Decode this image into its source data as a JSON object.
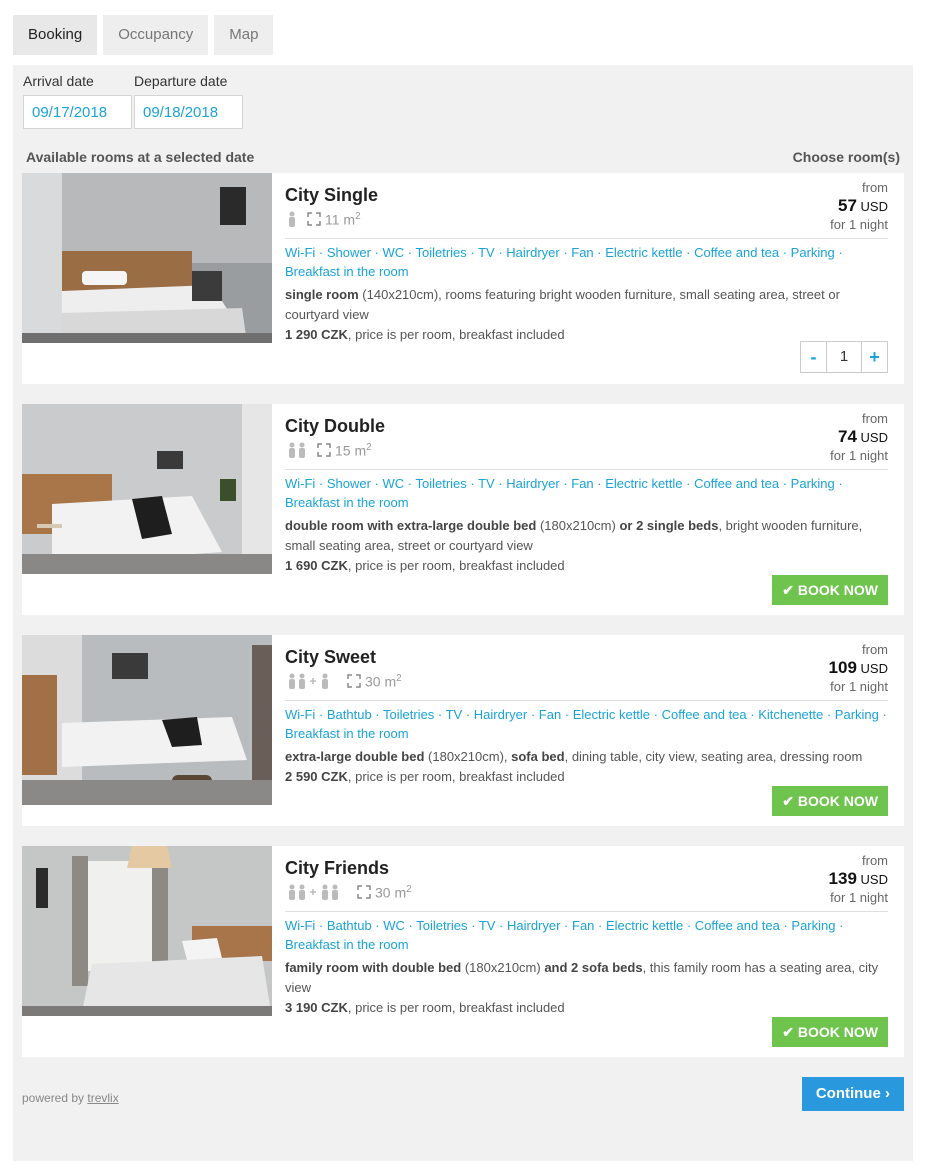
{
  "tabs": [
    {
      "label": "Booking"
    },
    {
      "label": "Occupancy"
    },
    {
      "label": "Map"
    }
  ],
  "dates": {
    "arrival_label": "Arrival date",
    "arrival_value": "09/17/2018",
    "departure_label": "Departure date",
    "departure_value": "09/18/2018"
  },
  "section": {
    "left": "Available rooms at a selected date",
    "right": "Choose room(s)"
  },
  "rooms": [
    {
      "name": "City Single",
      "size": "11 m",
      "price_from": "from",
      "price": "57",
      "currency": "USD",
      "nights": "for 1 night",
      "amenities": "Wi-Fi · Shower · WC · Toiletries · TV · Hairdryer · Fan · Electric kettle · Coffee and tea · Parking · Breakfast in the room",
      "desc_bold": "single room",
      "desc_rest": " (140x210cm), rooms featuring bright wooden furniture, small seating area, street or courtyard view",
      "price_czk": "1 290 CZK",
      "price_note": ", price is per room, breakfast included",
      "quantity": "1",
      "minus": "-",
      "plus": "+"
    },
    {
      "name": "City Double",
      "size": "15 m",
      "price_from": "from",
      "price": "74",
      "currency": "USD",
      "nights": "for 1 night",
      "amenities": "Wi-Fi · Shower · WC · Toiletries · TV · Hairdryer · Fan · Electric kettle · Coffee and tea · Parking · Breakfast in the room",
      "desc_bold": "double room with extra-large double bed",
      "desc_mid": " (180x210cm) ",
      "desc_bold2": "or 2 single beds",
      "desc_rest": ", bright wooden furniture, small seating area, street or courtyard view",
      "price_czk": "1 690 CZK",
      "price_note": ", price is per room, breakfast included",
      "book": "BOOK NOW"
    },
    {
      "name": "City Sweet",
      "size": "30 m",
      "price_from": "from",
      "price": "109",
      "currency": "USD",
      "nights": "for 1 night",
      "amenities": "Wi-Fi · Bathtub · Toiletries · TV · Hairdryer · Fan · Electric kettle · Coffee and tea · Kitchenette · Parking · Breakfast in the room",
      "desc_bold": "extra-large double bed",
      "desc_mid": " (180x210cm), ",
      "desc_bold2": "sofa bed",
      "desc_rest": ", dining table, city view, seating area, dressing room",
      "price_czk": "2 590 CZK",
      "price_note": ", price is per room, breakfast included",
      "book": "BOOK NOW"
    },
    {
      "name": "City Friends",
      "size": "30 m",
      "price_from": "from",
      "price": "139",
      "currency": "USD",
      "nights": "for 1 night",
      "amenities": "Wi-Fi · Bathtub · WC · Toiletries · TV · Hairdryer · Fan · Electric kettle · Coffee and tea · Parking · Breakfast in the room",
      "desc_bold": "family room with double bed",
      "desc_mid": " (180x210cm) ",
      "desc_bold2": "and 2 sofa beds",
      "desc_rest": ", this family room has a seating area, city view",
      "price_czk": "3 190 CZK",
      "price_note": ", price is per room, breakfast included",
      "book": "BOOK NOW"
    }
  ],
  "sup2": "2",
  "footer": {
    "powered_by": "powered by ",
    "brand": "trevlix",
    "continue": "Continue"
  },
  "colors": {
    "accent": "#1aa3d8",
    "book_button": "#6fc44e",
    "continue_button": "#2a98dc",
    "panel_bg": "#f1f1f1"
  }
}
